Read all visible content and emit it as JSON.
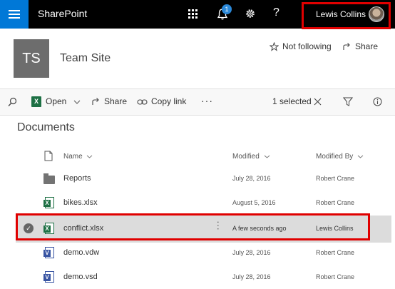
{
  "suite": {
    "brand": "SharePoint",
    "notification_count": "1",
    "help_glyph": "?",
    "user_name": "Lewis Collins"
  },
  "site": {
    "initials": "TS",
    "title": "Team Site",
    "follow_label": "Not following",
    "share_label": "Share"
  },
  "command_bar": {
    "open_label": "Open",
    "share_label": "Share",
    "copy_link_label": "Copy link",
    "more_label": "···",
    "selected_label": "1 selected"
  },
  "library": {
    "title": "Documents",
    "columns": {
      "name": "Name",
      "modified": "Modified",
      "modified_by": "Modified By"
    },
    "rows": [
      {
        "name": "Reports",
        "type": "folder",
        "modified": "July 28, 2016",
        "modified_by": "Robert Crane"
      },
      {
        "name": "bikes.xlsx",
        "type": "excel",
        "modified": "August 5, 2016",
        "modified_by": "Robert Crane"
      },
      {
        "name": "conflict.xlsx",
        "type": "excel",
        "modified": "A few seconds ago",
        "modified_by": "Lewis Collins",
        "selected": true
      },
      {
        "name": "demo.vdw",
        "type": "visio",
        "modified": "July 28, 2016",
        "modified_by": "Robert Crane"
      },
      {
        "name": "demo.vsd",
        "type": "visio",
        "modified": "July 28, 2016",
        "modified_by": "Robert Crane"
      }
    ]
  },
  "colors": {
    "suite_bar": "#000000",
    "app_launcher": "#0078d7",
    "highlight_box": "#e00000",
    "excel": "#1d7044",
    "visio": "#3955a3",
    "site_tile": "#6d6d6d",
    "selected_row": "#dcdcdc"
  },
  "icons": [
    "hamburger-icon",
    "app-launcher-icon",
    "bell-icon",
    "gear-icon",
    "help-icon",
    "star-icon",
    "share-icon",
    "search-icon",
    "excel-icon",
    "chevron-down-icon",
    "link-icon",
    "close-icon",
    "filter-icon",
    "info-icon",
    "file-icon",
    "folder-icon",
    "visio-icon",
    "check-icon"
  ]
}
